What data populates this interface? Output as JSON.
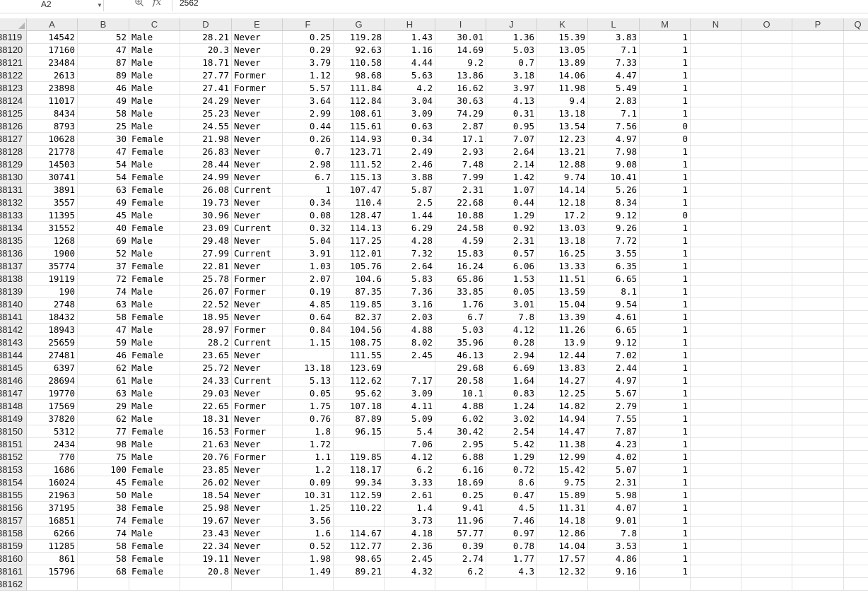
{
  "name_box": {
    "ref": "A2"
  },
  "formula_bar": {
    "fx_icon": "fx",
    "value": "2562"
  },
  "columns": [
    "A",
    "B",
    "C",
    "D",
    "E",
    "F",
    "G",
    "H",
    "I",
    "J",
    "K",
    "L",
    "M",
    "N",
    "O",
    "P",
    "Q"
  ],
  "row_numbers": [
    "38119",
    "38120",
    "38121",
    "38122",
    "38123",
    "38124",
    "38125",
    "38126",
    "38127",
    "38128",
    "38129",
    "38130",
    "38131",
    "38132",
    "38133",
    "38134",
    "38135",
    "38136",
    "38137",
    "38138",
    "38139",
    "38140",
    "38141",
    "38142",
    "38143",
    "38144",
    "38145",
    "38146",
    "38147",
    "38148",
    "38149",
    "38150",
    "38151",
    "38152",
    "38153",
    "38154",
    "38155",
    "38156",
    "38157",
    "38158",
    "38159",
    "38160",
    "38161",
    "38162"
  ],
  "rows": [
    [
      "14542",
      "52",
      "Male",
      "28.21",
      "Never",
      "0.25",
      "119.28",
      "1.43",
      "30.01",
      "1.36",
      "15.39",
      "3.83",
      "1"
    ],
    [
      "17160",
      "47",
      "Male",
      "20.3",
      "Never",
      "0.29",
      "92.63",
      "1.16",
      "14.69",
      "5.03",
      "13.05",
      "7.1",
      "1"
    ],
    [
      "23484",
      "87",
      "Male",
      "18.71",
      "Never",
      "3.79",
      "110.58",
      "4.44",
      "9.2",
      "0.7",
      "13.89",
      "7.33",
      "1"
    ],
    [
      "2613",
      "89",
      "Male",
      "27.77",
      "Former",
      "1.12",
      "98.68",
      "5.63",
      "13.86",
      "3.18",
      "14.06",
      "4.47",
      "1"
    ],
    [
      "23898",
      "46",
      "Male",
      "27.41",
      "Former",
      "5.57",
      "111.84",
      "4.2",
      "16.62",
      "3.97",
      "11.98",
      "5.49",
      "1"
    ],
    [
      "11017",
      "49",
      "Male",
      "24.29",
      "Never",
      "3.64",
      "112.84",
      "3.04",
      "30.63",
      "4.13",
      "9.4",
      "2.83",
      "1"
    ],
    [
      "8434",
      "58",
      "Male",
      "25.23",
      "Never",
      "2.99",
      "108.61",
      "3.09",
      "74.29",
      "0.31",
      "13.18",
      "7.1",
      "1"
    ],
    [
      "8793",
      "25",
      "Male",
      "24.55",
      "Never",
      "0.44",
      "115.61",
      "0.63",
      "2.87",
      "0.95",
      "13.54",
      "7.56",
      "0"
    ],
    [
      "10628",
      "30",
      "Female",
      "21.98",
      "Never",
      "0.26",
      "114.93",
      "0.34",
      "17.1",
      "7.07",
      "12.23",
      "4.97",
      "0"
    ],
    [
      "21778",
      "47",
      "Female",
      "26.83",
      "Never",
      "0.7",
      "123.71",
      "2.49",
      "2.93",
      "2.64",
      "13.21",
      "7.98",
      "1"
    ],
    [
      "14503",
      "54",
      "Male",
      "28.44",
      "Never",
      "2.98",
      "111.52",
      "2.46",
      "7.48",
      "2.14",
      "12.88",
      "9.08",
      "1"
    ],
    [
      "30741",
      "54",
      "Female",
      "24.99",
      "Never",
      "6.7",
      "115.13",
      "3.88",
      "7.99",
      "1.42",
      "9.74",
      "10.41",
      "1"
    ],
    [
      "3891",
      "63",
      "Female",
      "26.08",
      "Current",
      "1",
      "107.47",
      "5.87",
      "2.31",
      "1.07",
      "14.14",
      "5.26",
      "1"
    ],
    [
      "3557",
      "49",
      "Female",
      "19.73",
      "Never",
      "0.34",
      "110.4",
      "2.5",
      "22.68",
      "0.44",
      "12.18",
      "8.34",
      "1"
    ],
    [
      "11395",
      "45",
      "Male",
      "30.96",
      "Never",
      "0.08",
      "128.47",
      "1.44",
      "10.88",
      "1.29",
      "17.2",
      "9.12",
      "0"
    ],
    [
      "31552",
      "40",
      "Female",
      "23.09",
      "Current",
      "0.32",
      "114.13",
      "6.29",
      "24.58",
      "0.92",
      "13.03",
      "9.26",
      "1"
    ],
    [
      "1268",
      "69",
      "Male",
      "29.48",
      "Never",
      "5.04",
      "117.25",
      "4.28",
      "4.59",
      "2.31",
      "13.18",
      "7.72",
      "1"
    ],
    [
      "1900",
      "52",
      "Male",
      "27.99",
      "Current",
      "3.91",
      "112.01",
      "7.32",
      "15.83",
      "0.57",
      "16.25",
      "3.55",
      "1"
    ],
    [
      "35774",
      "37",
      "Female",
      "22.81",
      "Never",
      "1.03",
      "105.76",
      "2.64",
      "16.24",
      "6.06",
      "13.33",
      "6.35",
      "1"
    ],
    [
      "19119",
      "72",
      "Female",
      "25.78",
      "Former",
      "2.07",
      "104.6",
      "5.83",
      "65.86",
      "1.53",
      "11.51",
      "6.65",
      "1"
    ],
    [
      "190",
      "74",
      "Male",
      "26.07",
      "Former",
      "0.19",
      "87.35",
      "7.36",
      "33.85",
      "0.05",
      "13.59",
      "8.1",
      "1"
    ],
    [
      "2748",
      "63",
      "Male",
      "22.52",
      "Never",
      "4.85",
      "119.85",
      "3.16",
      "1.76",
      "3.01",
      "15.04",
      "9.54",
      "1"
    ],
    [
      "18432",
      "58",
      "Female",
      "18.95",
      "Never",
      "0.64",
      "82.37",
      "2.03",
      "6.7",
      "7.8",
      "13.39",
      "4.61",
      "1"
    ],
    [
      "18943",
      "47",
      "Male",
      "28.97",
      "Former",
      "0.84",
      "104.56",
      "4.88",
      "5.03",
      "4.12",
      "11.26",
      "6.65",
      "1"
    ],
    [
      "25659",
      "59",
      "Male",
      "28.2",
      "Current",
      "1.15",
      "108.75",
      "8.02",
      "35.96",
      "0.28",
      "13.9",
      "9.12",
      "1"
    ],
    [
      "27481",
      "46",
      "Female",
      "23.65",
      "Never",
      "",
      "111.55",
      "2.45",
      "46.13",
      "2.94",
      "12.44",
      "7.02",
      "1"
    ],
    [
      "6397",
      "62",
      "Male",
      "25.72",
      "Never",
      "13.18",
      "123.69",
      "",
      "29.68",
      "6.69",
      "13.83",
      "2.44",
      "1"
    ],
    [
      "28694",
      "61",
      "Male",
      "24.33",
      "Current",
      "5.13",
      "112.62",
      "7.17",
      "20.58",
      "1.64",
      "14.27",
      "4.97",
      "1"
    ],
    [
      "19770",
      "63",
      "Male",
      "29.03",
      "Never",
      "0.05",
      "95.62",
      "3.09",
      "10.1",
      "0.83",
      "12.25",
      "5.67",
      "1"
    ],
    [
      "17569",
      "29",
      "Male",
      "22.65",
      "Former",
      "1.75",
      "107.18",
      "4.11",
      "4.88",
      "1.24",
      "14.82",
      "2.79",
      "1"
    ],
    [
      "37820",
      "62",
      "Male",
      "18.31",
      "Never",
      "0.76",
      "87.89",
      "5.09",
      "6.02",
      "3.02",
      "14.94",
      "7.55",
      "1"
    ],
    [
      "5312",
      "77",
      "Female",
      "16.53",
      "Former",
      "1.8",
      "96.15",
      "5.4",
      "30.42",
      "2.54",
      "14.47",
      "7.87",
      "1"
    ],
    [
      "2434",
      "98",
      "Male",
      "21.63",
      "Never",
      "1.72",
      "",
      "7.06",
      "2.95",
      "5.42",
      "11.38",
      "4.23",
      "1"
    ],
    [
      "770",
      "75",
      "Male",
      "20.76",
      "Former",
      "1.1",
      "119.85",
      "4.12",
      "6.88",
      "1.29",
      "12.99",
      "4.02",
      "1"
    ],
    [
      "1686",
      "100",
      "Female",
      "23.85",
      "Never",
      "1.2",
      "118.17",
      "6.2",
      "6.16",
      "0.72",
      "15.42",
      "5.07",
      "1"
    ],
    [
      "16024",
      "45",
      "Female",
      "26.02",
      "Never",
      "0.09",
      "99.34",
      "3.33",
      "18.69",
      "8.6",
      "9.75",
      "2.31",
      "1"
    ],
    [
      "21963",
      "50",
      "Male",
      "18.54",
      "Never",
      "10.31",
      "112.59",
      "2.61",
      "0.25",
      "0.47",
      "15.89",
      "5.98",
      "1"
    ],
    [
      "37195",
      "38",
      "Female",
      "25.98",
      "Never",
      "1.25",
      "110.22",
      "1.4",
      "9.41",
      "4.5",
      "11.31",
      "4.07",
      "1"
    ],
    [
      "16851",
      "74",
      "Female",
      "19.67",
      "Never",
      "3.56",
      "",
      "3.73",
      "11.96",
      "7.46",
      "14.18",
      "9.01",
      "1"
    ],
    [
      "6266",
      "74",
      "Male",
      "23.43",
      "Never",
      "1.6",
      "114.67",
      "4.18",
      "57.77",
      "0.97",
      "12.86",
      "7.8",
      "1"
    ],
    [
      "11285",
      "58",
      "Female",
      "22.34",
      "Never",
      "0.52",
      "112.77",
      "2.36",
      "0.39",
      "0.78",
      "14.04",
      "3.53",
      "1"
    ],
    [
      "861",
      "58",
      "Female",
      "19.11",
      "Never",
      "1.98",
      "98.65",
      "2.45",
      "2.74",
      "1.77",
      "17.57",
      "4.86",
      "1"
    ],
    [
      "15796",
      "68",
      "Female",
      "20.8",
      "Never",
      "1.49",
      "89.21",
      "4.32",
      "6.2",
      "4.3",
      "12.32",
      "9.16",
      "1"
    ],
    [
      "",
      "",
      "",
      "",
      "",
      "",
      "",
      "",
      "",
      "",
      "",
      "",
      ""
    ]
  ]
}
